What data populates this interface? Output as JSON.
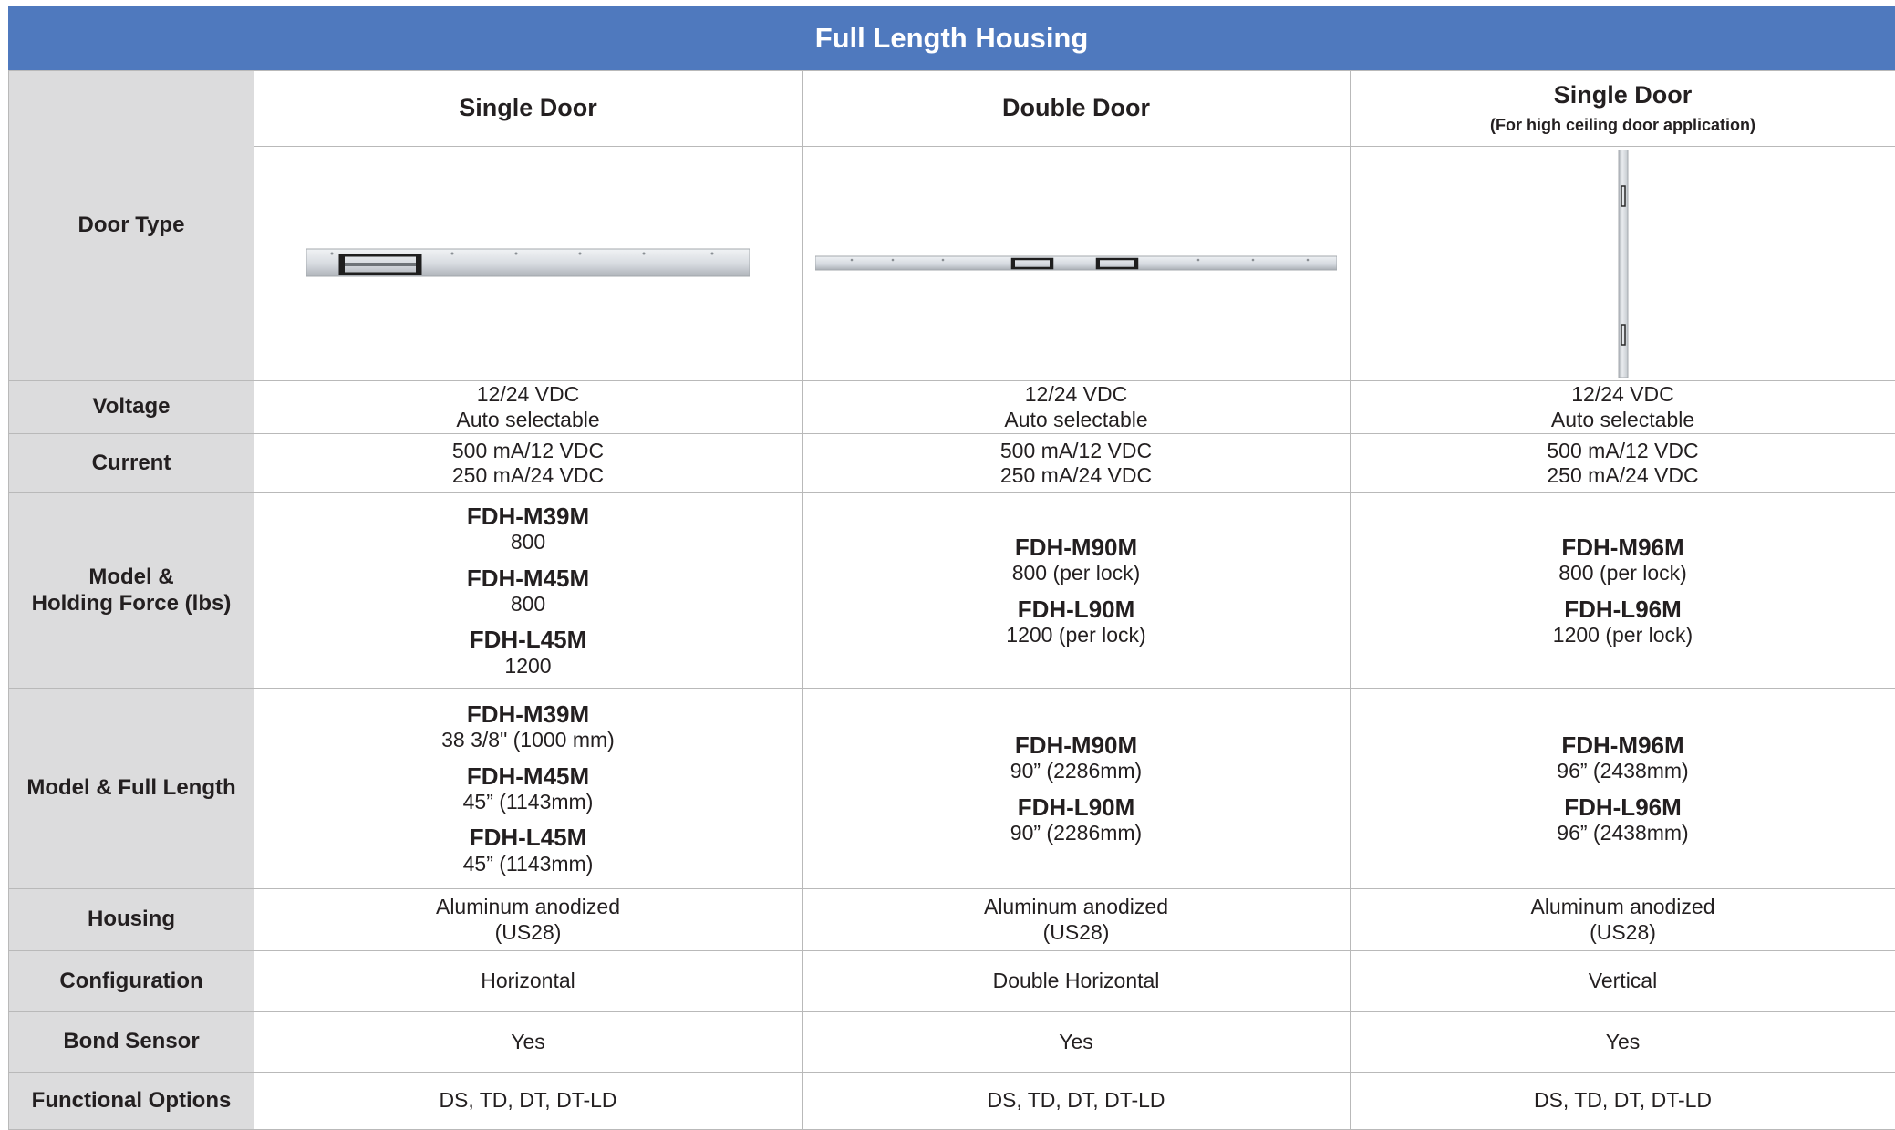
{
  "title": "Full Length Housing",
  "columns": [
    {
      "heading": "Single Door",
      "subheading": ""
    },
    {
      "heading": "Double Door",
      "subheading": ""
    },
    {
      "heading": "Single Door",
      "subheading": "(For high ceiling door application)"
    }
  ],
  "rows": {
    "door_type": {
      "label": "Door Type",
      "images": [
        "horizontal-housing-single-magnet",
        "horizontal-housing-double-magnet",
        "vertical-housing-double-magnet"
      ]
    },
    "voltage": {
      "label": "Voltage",
      "values": [
        [
          "12/24 VDC",
          "Auto selectable"
        ],
        [
          "12/24 VDC",
          "Auto selectable"
        ],
        [
          "12/24 VDC",
          "Auto selectable"
        ]
      ]
    },
    "current": {
      "label": "Current",
      "values": [
        [
          "500 mA/12 VDC",
          "250 mA/24 VDC"
        ],
        [
          "500 mA/12 VDC",
          "250 mA/24 VDC"
        ],
        [
          "500 mA/12 VDC",
          "250 mA/24 VDC"
        ]
      ]
    },
    "holding_force": {
      "label_line1": "Model &",
      "label_line2": "Holding Force (lbs)",
      "values": [
        [
          {
            "model": "FDH-M39M",
            "value": "800"
          },
          {
            "model": "FDH-M45M",
            "value": "800"
          },
          {
            "model": "FDH-L45M",
            "value": "1200"
          }
        ],
        [
          {
            "model": "FDH-M90M",
            "value": "800 (per lock)"
          },
          {
            "model": "FDH-L90M",
            "value": "1200 (per lock)"
          }
        ],
        [
          {
            "model": "FDH-M96M",
            "value": "800 (per lock)"
          },
          {
            "model": "FDH-L96M",
            "value": "1200 (per lock)"
          }
        ]
      ]
    },
    "full_length": {
      "label": "Model & Full Length",
      "values": [
        [
          {
            "model": "FDH-M39M",
            "value": "38 3/8\" (1000 mm)"
          },
          {
            "model": "FDH-M45M",
            "value": "45” (1143mm)"
          },
          {
            "model": "FDH-L45M",
            "value": "45” (1143mm)"
          }
        ],
        [
          {
            "model": "FDH-M90M",
            "value": "90” (2286mm)"
          },
          {
            "model": "FDH-L90M",
            "value": "90” (2286mm)"
          }
        ],
        [
          {
            "model": "FDH-M96M",
            "value": "96” (2438mm)"
          },
          {
            "model": "FDH-L96M",
            "value": "96” (2438mm)"
          }
        ]
      ]
    },
    "housing": {
      "label": "Housing",
      "values": [
        [
          "Aluminum anodized",
          "(US28)"
        ],
        [
          "Aluminum anodized",
          "(US28)"
        ],
        [
          "Aluminum anodized",
          "(US28)"
        ]
      ]
    },
    "configuration": {
      "label": "Configuration",
      "values": [
        "Horizontal",
        "Double Horizontal",
        "Vertical"
      ]
    },
    "bond_sensor": {
      "label": "Bond Sensor",
      "values": [
        "Yes",
        "Yes",
        "Yes"
      ]
    },
    "functional_options": {
      "label": "Functional Options",
      "values": [
        "DS, TD, DT, DT-LD",
        "DS, TD, DT, DT-LD",
        "DS, TD, DT, DT-LD"
      ]
    }
  },
  "colors": {
    "banner": "#4f79be",
    "label_column": "#dcdcdd",
    "border": "#b9b9b9"
  }
}
